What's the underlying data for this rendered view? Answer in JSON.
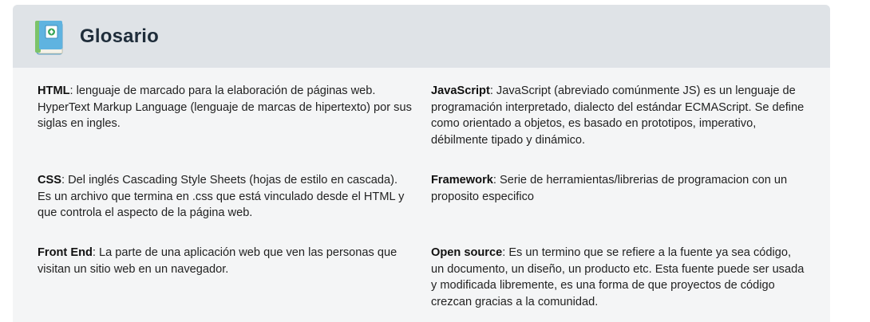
{
  "header": {
    "title": "Glosario",
    "icon": "book-icon"
  },
  "entries": [
    {
      "term": "HTML",
      "definition": ": lenguaje de marcado para la elaboración de páginas web. HyperText Markup Language (lenguaje de marcas de hipertexto) por sus siglas en ingles."
    },
    {
      "term": "JavaScript",
      "definition": ": JavaScript (abreviado comúnmente JS) es un lenguaje de programación interpretado, dialecto del estándar ECMAScript. Se define como orientado a objetos, es basado en prototipos, imperativo, débilmente tipado y dinámico."
    },
    {
      "term": "CSS",
      "definition": ": Del inglés Cascading Style Sheets (hojas de estilo en cascada). Es un archivo que termina en .css que está vinculado desde el HTML y que controla el aspecto de la página web."
    },
    {
      "term": "Framework",
      "definition": ": Serie de herramientas/librerias de programacion con un proposito especifico"
    },
    {
      "term": "Front End",
      "definition": ": La parte de una aplicación web que ven las personas que visitan un sitio web en un navegador."
    },
    {
      "term": "Open source",
      "definition": ": Es un termino que se refiere a la fuente ya sea código, un documento, un diseño, un producto etc. Esta fuente puede ser usada y modificada libremente, es una forma de que proyectos de código crezcan gracias a la comunidad."
    }
  ]
}
